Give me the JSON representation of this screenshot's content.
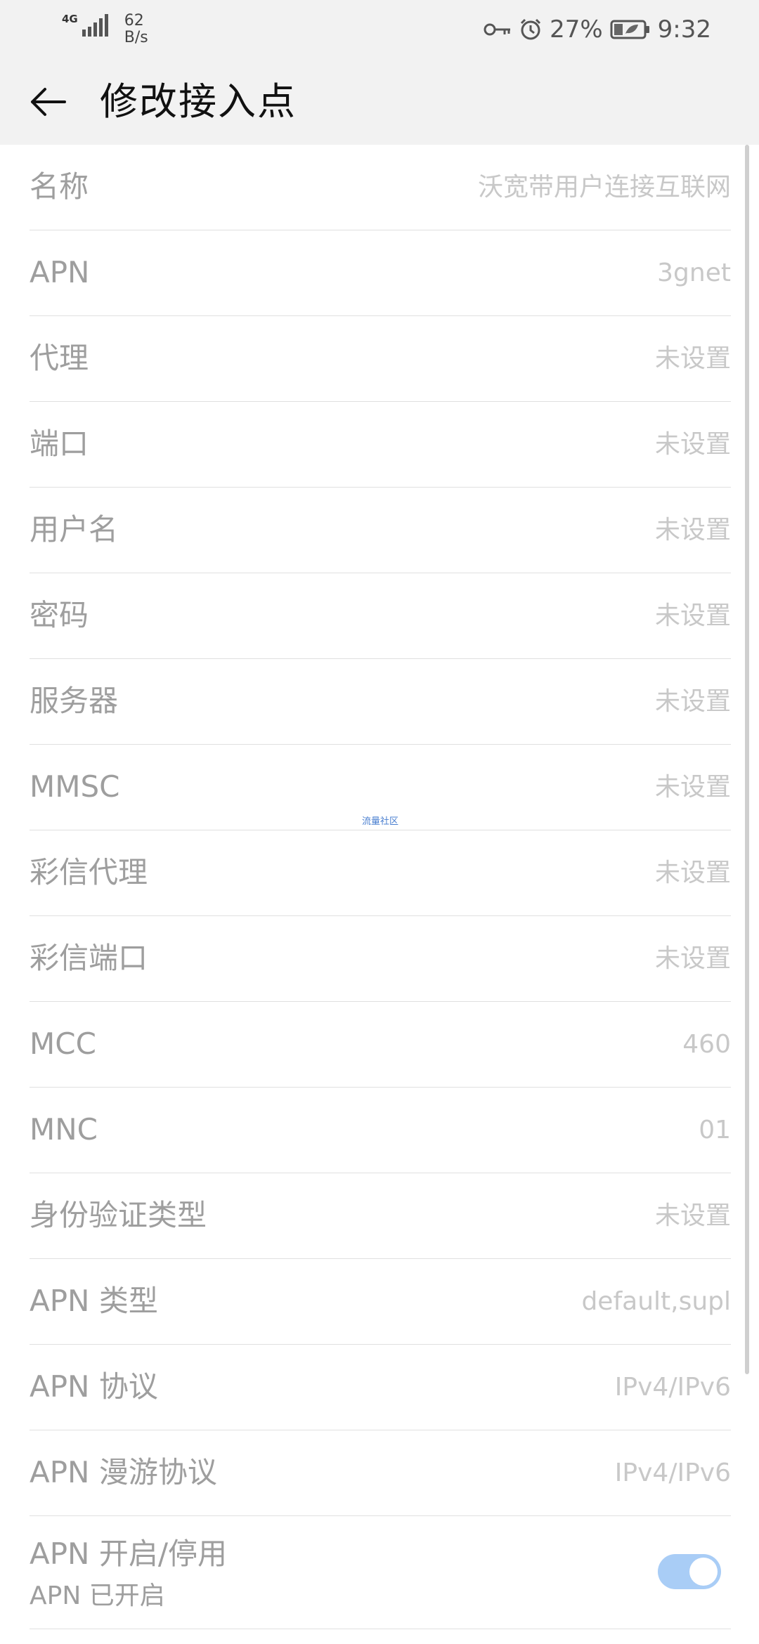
{
  "status_bar": {
    "network_type": "4G",
    "network_speed_value": "62",
    "network_speed_unit": "B/s",
    "battery_percent": "27%",
    "time": "9:32",
    "icons": [
      "signal-icon",
      "key-icon",
      "alarm-icon",
      "battery-icon"
    ]
  },
  "header": {
    "title": "修改接入点",
    "back_icon": "arrow-left-icon"
  },
  "apn_fields": [
    {
      "label": "名称",
      "value": "沃宽带用户连接互联网"
    },
    {
      "label": "APN",
      "value": "3gnet"
    },
    {
      "label": "代理",
      "value": "未设置"
    },
    {
      "label": "端口",
      "value": "未设置"
    },
    {
      "label": "用户名",
      "value": "未设置"
    },
    {
      "label": "密码",
      "value": "未设置"
    },
    {
      "label": "服务器",
      "value": "未设置"
    },
    {
      "label": "MMSC",
      "value": "未设置"
    },
    {
      "label": "彩信代理",
      "value": "未设置"
    },
    {
      "label": "彩信端口",
      "value": "未设置"
    },
    {
      "label": "MCC",
      "value": "460"
    },
    {
      "label": "MNC",
      "value": "01"
    },
    {
      "label": "身份验证类型",
      "value": "未设置"
    },
    {
      "label": "APN 类型",
      "value": "default,supl"
    },
    {
      "label": "APN 协议",
      "value": "IPv4/IPv6"
    },
    {
      "label": "APN 漫游协议",
      "value": "IPv4/IPv6"
    }
  ],
  "apn_toggle": {
    "label": "APN 开启/停用",
    "sub_label": "APN 已开启",
    "enabled": true
  },
  "watermark": "流量社区",
  "colors": {
    "background": "#ffffff",
    "bar_background": "#f2f2f2",
    "label_text": "#9e9e9e",
    "value_text": "#c8c8c8",
    "switch_on": "#a9cdf6"
  }
}
